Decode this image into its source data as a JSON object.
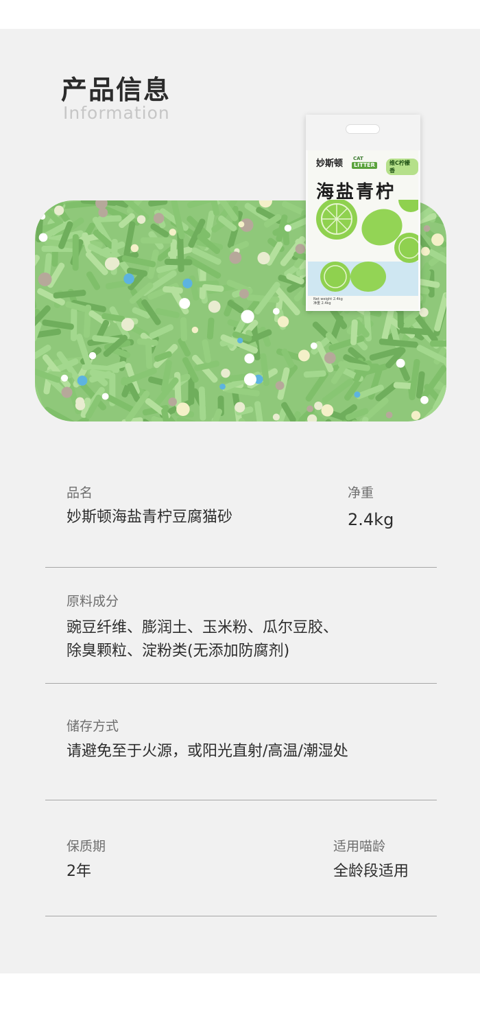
{
  "header": {
    "title_cn": "产品信息",
    "title_en": "Information"
  },
  "bag": {
    "brand": "妙斯顿",
    "cat": "CAT",
    "litter": "LITTER",
    "badge": "维C柠檬香",
    "name": "海盐青柠",
    "weight_en": "Net weight 2.4kg",
    "weight_cn": "净重 2.4kg"
  },
  "info": {
    "product_name_label": "品名",
    "product_name_value": "妙斯顿海盐青柠豆腐猫砂",
    "net_weight_label": "净重",
    "net_weight_value": "2.4kg",
    "ingredients_label": "原料成分",
    "ingredients_line1": "豌豆纤维、膨润土、玉米粉、瓜尔豆胶、",
    "ingredients_line2": "除臭颗粒、淀粉类(无添加防腐剂)",
    "storage_label": "储存方式",
    "storage_value": "请避免至于火源，或阳光直射/高温/潮湿处",
    "shelf_life_label": "保质期",
    "shelf_life_value": "2年",
    "age_label": "适用喵龄",
    "age_value": "全龄段适用"
  },
  "colors": {
    "panel_bg": "#f1f1f1",
    "litter_green": "#8fc87a",
    "pellet_blue": "#5db3e0",
    "lime_green": "#8fd14f"
  }
}
